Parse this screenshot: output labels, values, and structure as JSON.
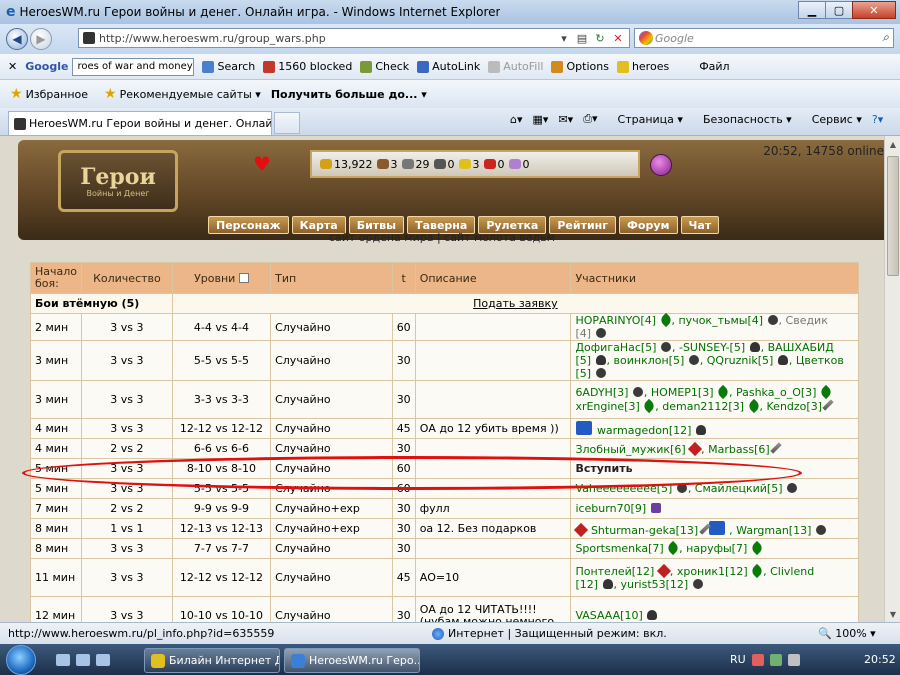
{
  "window": {
    "title": "HeroesWM.ru Герои войны и денег. Онлайн игра. - Windows Internet Explorer"
  },
  "address": {
    "url": "http://www.heroeswm.ru/group_wars.php"
  },
  "search": {
    "placeholder": "Google"
  },
  "toolbar": {
    "google_label": "Google",
    "google_query": "roes of war and money",
    "search_label": "Search",
    "blocked": "1560 blocked",
    "check": "Check",
    "autolink": "AutoLink",
    "autofill": "AutoFill",
    "options": "Options",
    "heroes": "heroes",
    "file_menu": "Файл"
  },
  "favbar": {
    "favorites": "Избранное",
    "recommended": "Рекомендуемые сайты",
    "more": "Получить больше до..."
  },
  "tabs": {
    "active": "HeroesWM.ru Герои войны и денег. Онлайн иг..."
  },
  "commands": {
    "page": "Страница",
    "security": "Безопасность",
    "service": "Сервис"
  },
  "header": {
    "logo_main": "Герои",
    "logo_sub": "Войны и Денег",
    "online": "20:52, 14758 online",
    "resources": [
      {
        "value": "13,922",
        "color": "#d4a017"
      },
      {
        "value": "3",
        "color": "#8b5a2b"
      },
      {
        "value": "29",
        "color": "#777777"
      },
      {
        "value": "0",
        "color": "#555555"
      },
      {
        "value": "3",
        "color": "#e0c020"
      },
      {
        "value": "0",
        "color": "#cc2222"
      },
      {
        "value": "0",
        "color": "#b080d0"
      }
    ],
    "nav": [
      "Персонаж",
      "Карта",
      "Битвы",
      "Таверна",
      "Рулетка",
      "Рейтинг",
      "Форум",
      "Чат"
    ],
    "sites": "сайт ордена мира | сайт молота ведьм"
  },
  "table": {
    "headers": {
      "start": "Начало боя:",
      "count": "Количество",
      "levels": "Уровни",
      "type": "Тип",
      "t": "t",
      "desc": "Описание",
      "participants": "Участники"
    },
    "section_title": "Бои втёмную (5)",
    "apply_link": "Подать заявку",
    "join_label": "Вступить",
    "rows": [
      {
        "start": "2 мин",
        "count": "3 vs 3",
        "levels": "4-4 vs 4-4",
        "type": "Случайно",
        "t": "60",
        "desc": "",
        "p1": "НОРАRINYO[4]",
        "p2": ", пучок_тьмы[4]",
        "p3": ", Сведик",
        "p4": "[4]"
      },
      {
        "start": "3 мин",
        "count": "3 vs 3",
        "levels": "5-5 vs 5-5",
        "type": "Случайно",
        "t": "30",
        "desc": "",
        "p1": "ДофигаНас[5]",
        "p2": ", -SUNSEY-[5]",
        "p3": ", ВАШХАБИД",
        "p4": "[5]",
        "p5": ", воинклон[5]",
        "p6": ", QQruznik[5]",
        "p7": ", Цветков",
        "p8": "[5]"
      },
      {
        "start": "3 мин",
        "count": "3 vs 3",
        "levels": "3-3 vs 3-3",
        "type": "Случайно",
        "t": "30",
        "desc": "",
        "p1": "6АDYН[3]",
        "p2": ", НОМЕР1[3]",
        "p3": ", Pashka_o_O[3]",
        "p4": "xrEngine[3]",
        "p5": ", deman2112[3]",
        "p6": ", Kendzo[3]"
      },
      {
        "start": "4 мин",
        "count": "3 vs 3",
        "levels": "12-12 vs 12-12",
        "type": "Случайно",
        "t": "45",
        "desc": "ОА до 12 убить время ))",
        "p1": "warmagedon[12]"
      },
      {
        "start": "4 мин",
        "count": "2 vs 2",
        "levels": "6-6 vs 6-6",
        "type": "Случайно",
        "t": "30",
        "desc": "",
        "p1": "Злобный_мужик[6]",
        "p2": ", Marbass[6]"
      },
      {
        "start": "5 мин",
        "count": "3 vs 3",
        "levels": "8-10 vs 8-10",
        "type": "Случайно",
        "t": "60",
        "desc": ""
      },
      {
        "start": "5 мин",
        "count": "3 vs 3",
        "levels": "5-5 vs 5-5",
        "type": "Случайно",
        "t": "60",
        "desc": "",
        "p1": "Vaheeeeeeeee[5]",
        "p2": ", Смайлецкий[5]"
      },
      {
        "start": "7 мин",
        "count": "2 vs 2",
        "levels": "9-9 vs 9-9",
        "type": "Случайно+exp",
        "t": "30",
        "desc": "фулл",
        "p1": "iceburn70[9]"
      },
      {
        "start": "8 мин",
        "count": "1 vs 1",
        "levels": "12-13 vs 12-13",
        "type": "Случайно+exp",
        "t": "30",
        "desc": "оа 12. Без подарков",
        "p1": "Shturman-geka[13]",
        "p2": ", Wargman[13]"
      },
      {
        "start": "8 мин",
        "count": "3 vs 3",
        "levels": "7-7 vs 7-7",
        "type": "Случайно",
        "t": "30",
        "desc": "",
        "p1": "Sportsmenka[7]",
        "p2": ", наруфы[7]"
      },
      {
        "start": "11 мин",
        "count": "3 vs 3",
        "levels": "12-12 vs 12-12",
        "type": "Случайно",
        "t": "45",
        "desc": "АО=10",
        "p1": "Понтелей[12]",
        "p2": ", хроник1[12]",
        "p3": ", Clivlend",
        "p4": "[12]",
        "p5": ", yurist53[12]"
      },
      {
        "start": "12 мин",
        "count": "3 vs 3",
        "levels": "10-10 vs 10-10",
        "type": "Случайно",
        "t": "30",
        "desc": "ОА до 12 ЧИТАТЬ!!!! (нубам можно немного",
        "p1": "VASAAA[10]"
      }
    ]
  },
  "status": {
    "url": "http://www.heroeswm.ru/pl_info.php?id=635559",
    "zone": "Интернет | Защищенный режим: вкл.",
    "zoom": "100%"
  },
  "taskbar": {
    "item1": "Билайн Интернет Д...",
    "item2": "HeroesWM.ru Геро...",
    "lang": "RU",
    "clock": "20:52"
  }
}
